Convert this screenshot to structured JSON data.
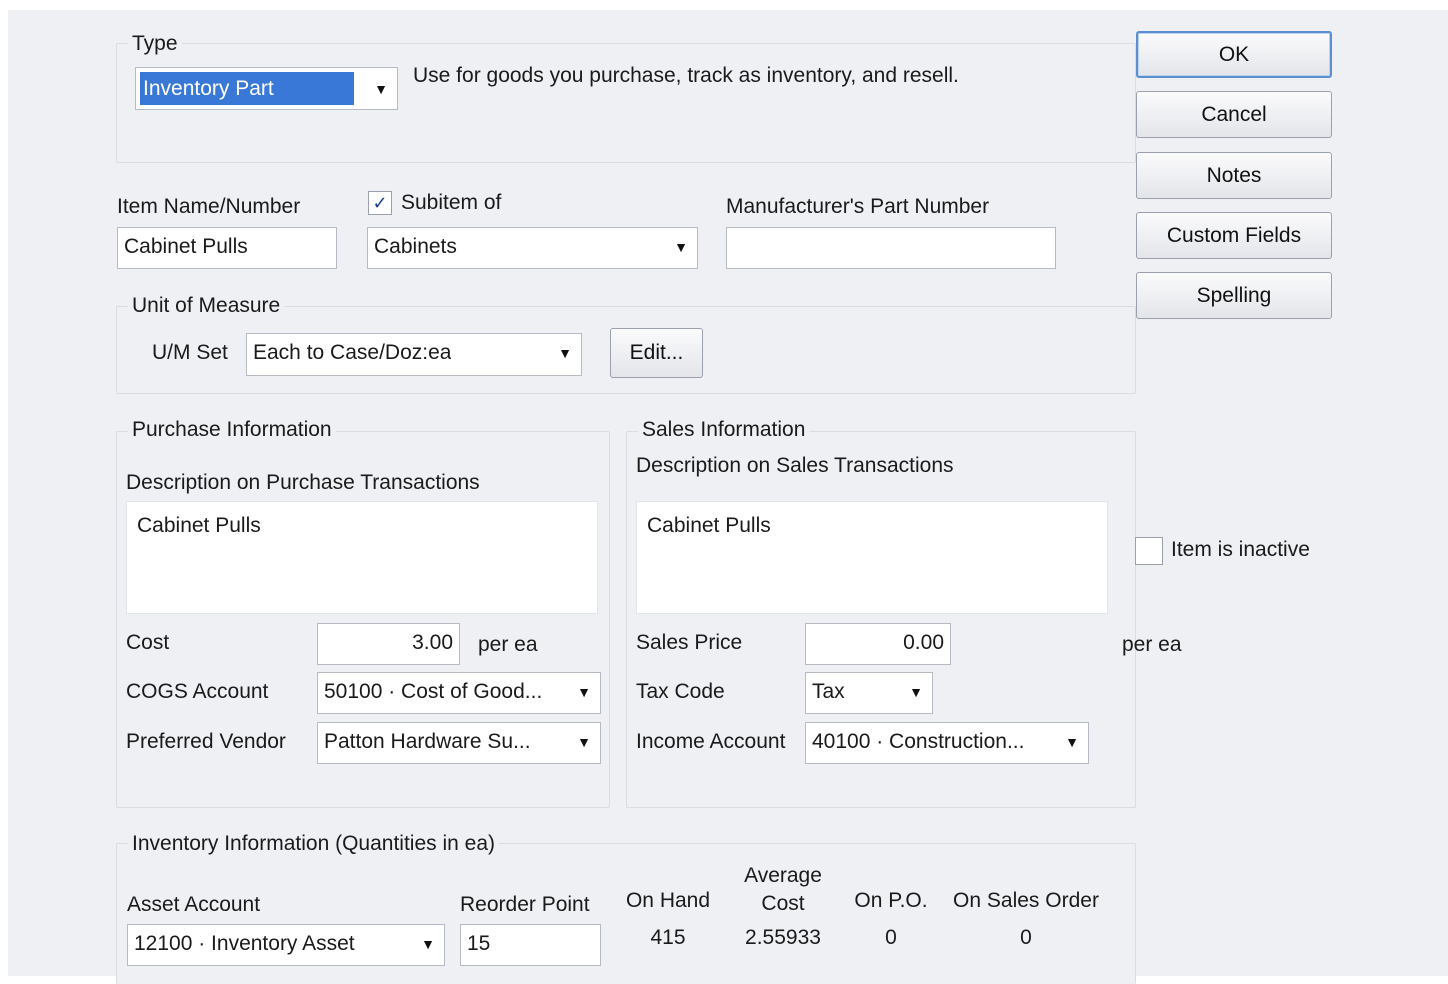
{
  "type_section": {
    "label": "Type",
    "selected": "Inventory Part",
    "description": "Use for goods you purchase, track as inventory, and resell."
  },
  "buttons": {
    "ok": "OK",
    "cancel": "Cancel",
    "notes": "Notes",
    "custom_fields": "Custom Fields",
    "spelling": "Spelling",
    "edit": "Edit..."
  },
  "item": {
    "name_label": "Item Name/Number",
    "name_value": "Cabinet Pulls",
    "subitem_label": "Subitem of",
    "subitem_checked": true,
    "subitem_value": "Cabinets",
    "mfr_label": "Manufacturer's Part Number",
    "mfr_value": ""
  },
  "unit_of_measure": {
    "label": "Unit of Measure",
    "set_label": "U/M Set",
    "set_value": "Each to Case/Doz:ea"
  },
  "purchase": {
    "label": "Purchase Information",
    "desc_label": "Description on Purchase Transactions",
    "desc_value": "Cabinet Pulls",
    "cost_label": "Cost",
    "cost_value": "3.00",
    "cost_unit": "per ea",
    "cogs_label": "COGS Account",
    "cogs_value": "50100 · Cost of Good...",
    "vendor_label": "Preferred Vendor",
    "vendor_value": "Patton Hardware Su..."
  },
  "sales": {
    "label": "Sales Information",
    "desc_label": "Description on Sales Transactions",
    "desc_value": "Cabinet Pulls",
    "price_label": "Sales Price",
    "price_value": "0.00",
    "price_unit": "per ea",
    "tax_label": "Tax Code",
    "tax_value": "Tax",
    "income_label": "Income Account",
    "income_value": "40100 · Construction..."
  },
  "inactive": {
    "label": "Item is inactive",
    "checked": false
  },
  "inventory": {
    "label": "Inventory Information (Quantities in ea)",
    "asset_label": "Asset Account",
    "asset_value": "12100 · Inventory Asset",
    "reorder_label": "Reorder Point",
    "reorder_value": "15",
    "on_hand_label": "On Hand",
    "on_hand_value": "415",
    "avg_cost_label_1": "Average",
    "avg_cost_label_2": "Cost",
    "avg_cost_value": "2.55933",
    "on_po_label": "On P.O.",
    "on_po_value": "0",
    "on_so_label": "On Sales Order",
    "on_so_value": "0"
  },
  "icons": {
    "dropdown": "chevron-down-icon",
    "check": "checkmark-icon"
  },
  "colors": {
    "selection": "#3a78d8",
    "dialog_bg": "#eef0f4",
    "default_button_border": "#5b8fcf"
  }
}
